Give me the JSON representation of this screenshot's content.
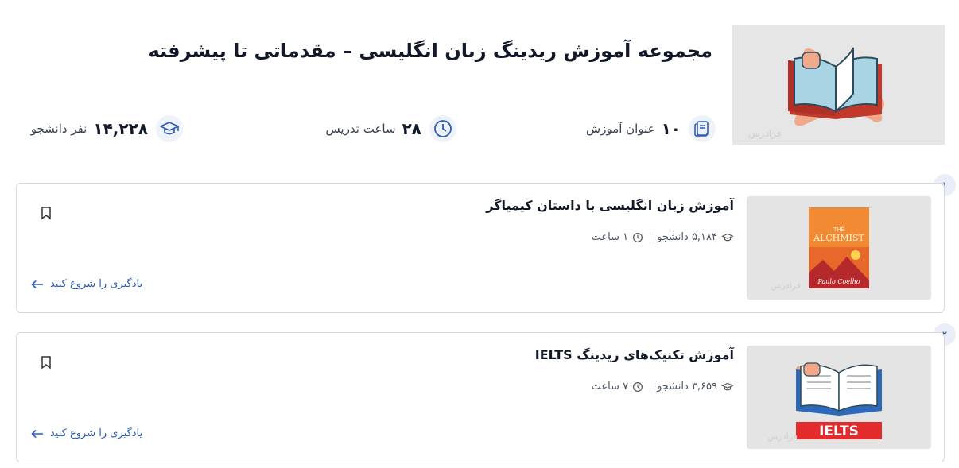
{
  "header": {
    "title": "مجموعه آموزش ریدینگ زبان انگلیسی – مقدماتی تا پیشرفته",
    "hero_watermark": "فرادرس"
  },
  "stats": {
    "courses": {
      "value": "۱۰",
      "label": "عنوان آموزش",
      "icon": "books-icon"
    },
    "hours": {
      "value": "۲۸",
      "label": "ساعت تدریس",
      "icon": "clock-icon"
    },
    "students": {
      "value": "۱۴,۲۲۸",
      "label": "نفر دانشجو",
      "icon": "graduation-cap-icon"
    }
  },
  "courses": [
    {
      "index": "۱",
      "title": "آموزش زبان انگلیسی با داستان کیمیاگر",
      "students": "۵,۱۸۴ دانشجو",
      "duration": "۱ ساعت",
      "link": "یادگیری را شروع کنید",
      "thumb_text": {
        "small": "THE",
        "big": "ALCHMIST",
        "author": "Paulo Coelho",
        "watermark": "فرادرس"
      }
    },
    {
      "index": "۲",
      "title": "آموزش تکنیک‌های ریدینگ IELTS",
      "students": "۳,۶۵۹ دانشجو",
      "duration": "۷ ساعت",
      "link": "یادگیری را شروع کنید",
      "thumb_text": {
        "badge": "IELTS",
        "watermark": "فرادرس"
      }
    }
  ],
  "colors": {
    "accent": "#2d5bb9",
    "icon_bg": "#eef2fb",
    "card_border": "#d6d9de"
  }
}
